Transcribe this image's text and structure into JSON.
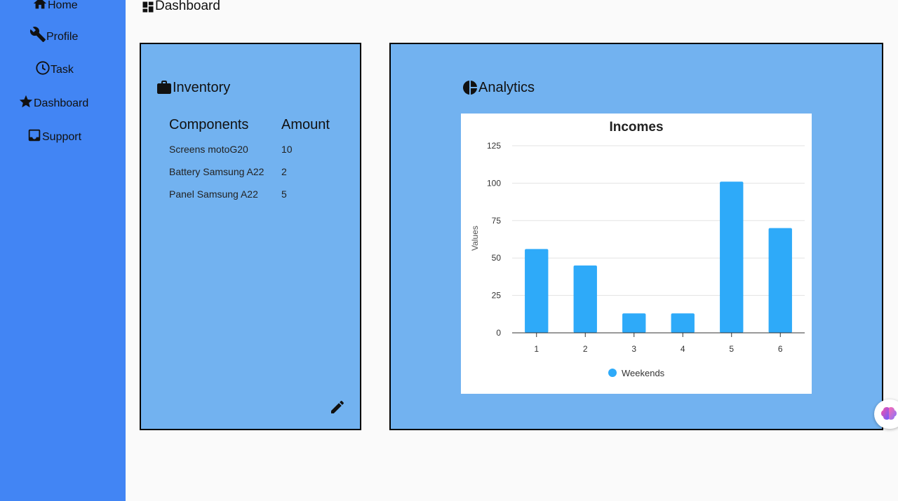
{
  "sidebar": {
    "items": [
      {
        "label": "Home",
        "icon": "home-icon"
      },
      {
        "label": "Profile",
        "icon": "wrench-icon"
      },
      {
        "label": "Task",
        "icon": "clock-icon"
      },
      {
        "label": "Dashboard",
        "icon": "star-icon"
      },
      {
        "label": "Support",
        "icon": "inbox-icon"
      }
    ]
  },
  "header": {
    "title": "Dashboard",
    "icon": "dashboard-icon"
  },
  "inventory": {
    "title": "Inventory",
    "icon": "briefcase-icon",
    "columns": [
      "Components",
      "Amount"
    ],
    "rows": [
      [
        "Screens motoG20",
        "10"
      ],
      [
        "Battery Samsung A22",
        "2"
      ],
      [
        "Panel Samsung A22",
        "5"
      ]
    ],
    "edit_icon": "pencil-icon"
  },
  "analytics": {
    "title": "Analytics",
    "icon": "pie-chart-icon"
  },
  "chart_data": {
    "type": "bar",
    "title": "Incomes",
    "xlabel": "",
    "ylabel": "Values",
    "categories": [
      "1",
      "2",
      "3",
      "4",
      "5",
      "6"
    ],
    "series": [
      {
        "name": "Weekends",
        "values": [
          56,
          45,
          13,
          13,
          101,
          70
        ],
        "color": "#2eaaf9"
      }
    ],
    "ylim": [
      0,
      125
    ],
    "yticks": [
      0,
      25,
      50,
      75,
      100,
      125
    ],
    "grid": true,
    "legend": "bottom"
  },
  "colors": {
    "sidebar": "#4285f4",
    "card": "#72b2f0",
    "bar": "#2eaaf9"
  }
}
